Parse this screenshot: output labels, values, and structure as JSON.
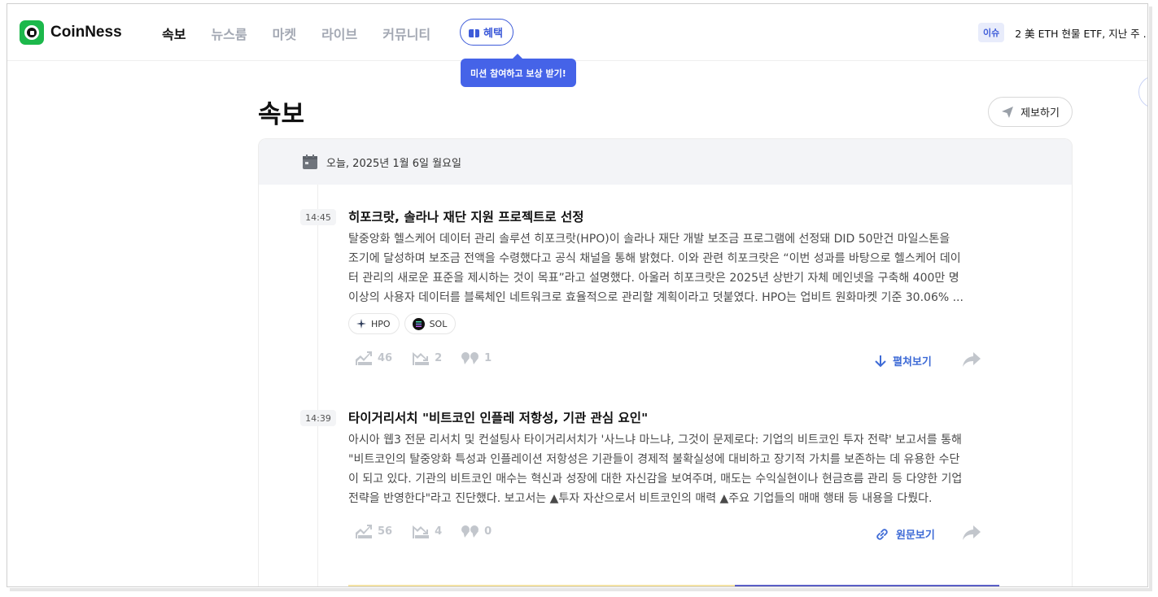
{
  "header": {
    "brand": "CoinNess",
    "nav": [
      "속보",
      "뉴스룸",
      "마켓",
      "라이브",
      "커뮤니티"
    ],
    "benefit_label": "혜택",
    "tooltip": "미션 참여하고 보상 받기!",
    "issue_badge": "이슈",
    "issue_text": "2 美 ETH 현물 ETF, 지난 주 ..."
  },
  "page": {
    "title": "속보",
    "report_label": "제보하기",
    "date": "오늘, 2025년 1월 6일 월요일"
  },
  "items": [
    {
      "time": "14:45",
      "title": "히포크랏, 솔라나 재단 지원 프로젝트로 선정",
      "body": [
        "탈중앙화 헬스케어 데이터 관리 솔루션 히포크랏(HPO)이 솔라나 재단 개발 보조금 프로그램에 선정돼 DID 50만건 마일스톤을",
        "조기에 달성하며 보조금 전액을 수령했다고 공식 채널을 통해 밝혔다. 이와 관련 히포크랏은 “이번 성과를 바탕으로 헬스케어 데이",
        "터 관리의 새로운 표준을 제시하는 것이 목표”라고 설명했다. 아울러 히포크랏은 2025년 상반기 자체 메인넷을 구축해 400만 명",
        "이상의 사용자 데이터를 블록체인 네트워크로 효율적으로 관리할 계획이라고 덧붙였다. HPO는 업비트 원화마켓 기준 30.06% ..."
      ],
      "tags": [
        "HPO",
        "SOL"
      ],
      "bullish": "46",
      "bearish": "2",
      "comments": "1",
      "expand_label": "펼쳐보기"
    },
    {
      "time": "14:39",
      "title": "타이거리서치 \"비트코인 인플레 저항성, 기관 관심 요인\"",
      "body": [
        "아시아 웹3 전문 리서치 및 컨설팅사 타이거리서치가 '사느냐 마느냐, 그것이 문제로다: 기업의 비트코인 투자 전략' 보고서를 통해",
        "\"비트코인의 탈중앙화 특성과 인플레이션 저항성은 기관들이 경제적 불확실성에 대비하고 장기적 가치를 보존하는 데 유용한 수단",
        "이 되고 있다. 기관의 비트코인 매수는 혁신과 성장에 대한 자신감을 보여주며, 매도는 수익실현이나 현금흐름 관리 등 다양한 기업",
        "전략을 반영한다\"라고 진단했다. 보고서는 ▲투자 자산으로서 비트코인의 매력 ▲주요 기업들의 매매 행태 등 내용을 다뤘다."
      ],
      "bullish": "56",
      "bearish": "4",
      "comments": "0",
      "source_label": "원문보기"
    }
  ]
}
